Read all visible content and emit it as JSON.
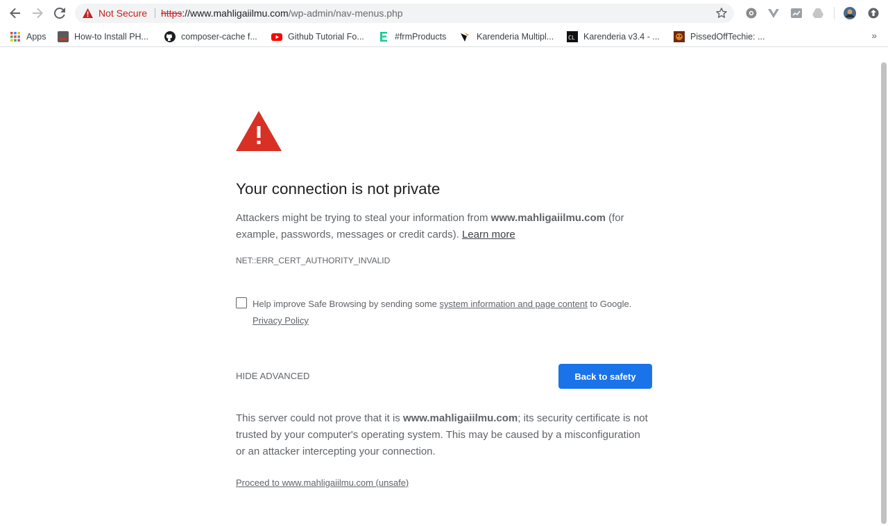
{
  "browser": {
    "security_label": "Not Secure",
    "url_scheme": "https",
    "url_host": "://www.mahligaiilmu.com",
    "url_path": "/wp-admin/nav-menus.php",
    "bookmarks": [
      {
        "label": "Apps",
        "icon": "apps-grid-icon"
      },
      {
        "label": "How-to Install PH...",
        "icon": "php-favicon"
      },
      {
        "label": "composer-cache f...",
        "icon": "github-icon"
      },
      {
        "label": "Github Tutorial Fo...",
        "icon": "youtube-icon"
      },
      {
        "label": "#frmProducts",
        "icon": "e-favicon"
      },
      {
        "label": "Karenderia Multipl...",
        "icon": "karenderia-favicon"
      },
      {
        "label": "Karenderia v3.4 - ...",
        "icon": "codecanyon-favicon"
      },
      {
        "label": "PissedOffTechie: ...",
        "icon": "pissedofftechie-favicon"
      }
    ],
    "more_label": "»"
  },
  "interstitial": {
    "heading": "Your connection is not private",
    "msg_part1": "Attackers might be trying to steal your information from ",
    "msg_host": "www.mahligaiilmu.com",
    "msg_part2": " (for example, passwords, messages or credit cards). ",
    "learn_more": "Learn more",
    "error_code": "NET::ERR_CERT_AUTHORITY_INVALID",
    "sb_part1": "Help improve Safe Browsing by sending some ",
    "sb_link": "system information and page content",
    "sb_part2": " to Google.",
    "privacy_policy": "Privacy Policy",
    "hide_advanced": "HIDE ADVANCED",
    "back_button": "Back to safety",
    "details_part1": "This server could not prove that it is ",
    "details_host": "www.mahligaiilmu.com",
    "details_part2": "; its security certificate is not trusted by your computer's operating system. This may be caused by a misconfiguration or an attacker intercepting your connection.",
    "proceed_link": "Proceed to www.mahligaiilmu.com (unsafe)"
  },
  "colors": {
    "danger": "#c5221f",
    "warning_icon": "#d93025",
    "primary": "#1a73e8"
  }
}
